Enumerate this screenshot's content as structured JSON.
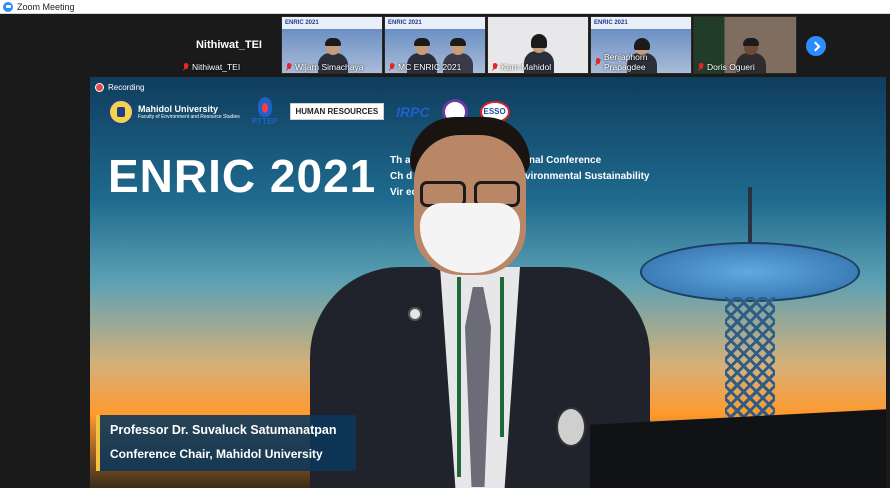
{
  "window": {
    "title": "Zoom Meeting"
  },
  "colors": {
    "accent": "#2d8cff",
    "muted_icon": "#e02828",
    "recording_dot": "#e24b4b"
  },
  "participants": [
    {
      "name": "Nithiwat_TEI",
      "video": false,
      "display": "Nithiwat_TEI"
    },
    {
      "name": "Wijarn Simachaya",
      "video": true,
      "banner": "ENRIC 2021"
    },
    {
      "name": "MC ENRIC 2021",
      "video": true,
      "banner": "ENRIC 2021"
    },
    {
      "name": "Karn Mahidol",
      "video": true
    },
    {
      "name": "Benjaphorn Prapagdee",
      "video": true,
      "banner": "ENRIC 2021"
    },
    {
      "name": "Doris Ogueri",
      "video": true
    }
  ],
  "stage": {
    "recording_label": "Recording",
    "logos": {
      "mahidol_line1": "Mahidol University",
      "mahidol_line2": "Faculty of Environment and Resource Studies",
      "pttep": "PTTEP",
      "hr": "HUMAN RESOURCES",
      "irpc": "IRPC",
      "esso": "ESSO"
    },
    "conference_title": "ENRIC 2021",
    "conference_lines": [
      "Th            atural Resource International Conference",
      "Ch               d Transformations for Environmental Sustainability",
      "Vir                   ecember, 2021"
    ],
    "speaker_name": "Professor Dr. Suvaluck Satumanatpan",
    "speaker_title": "Conference Chair, Mahidol University"
  }
}
